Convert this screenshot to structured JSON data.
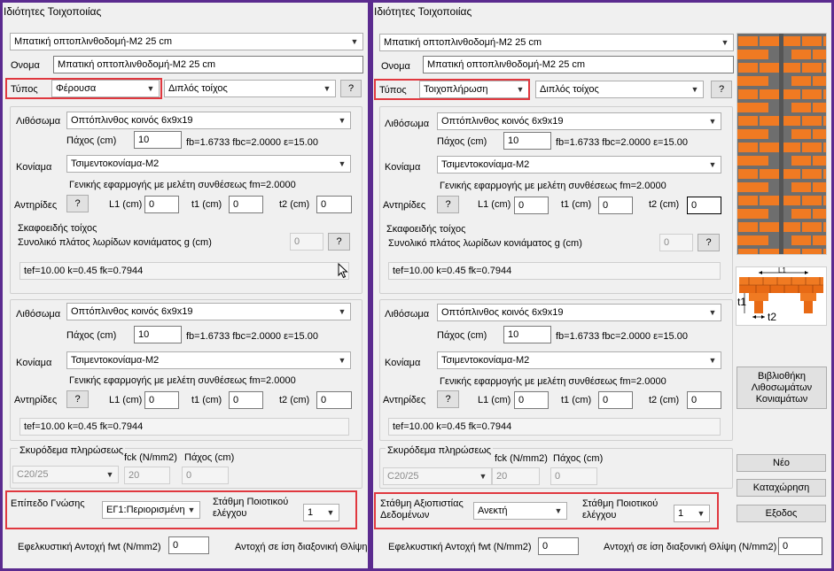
{
  "left": {
    "title": "Ιδιότητες Τοιχοποιίας",
    "wall_type": "Μπατική οπτοπλινθοδομή-Μ2 25 cm",
    "name_label": "Ονομα",
    "name_value": "Μπατική οπτοπλινθοδομή-Μ2 25 cm",
    "type_label": "Τύπος",
    "type_value": "Φέρουσα",
    "wall_kind": "Διπλός τοίχος",
    "help": "?",
    "layer1": {
      "block_label": "Λιθόσωμα",
      "block": "Οπτόπλινθος κοινός 6x9x19",
      "thickness_label": "Πάχος (cm)",
      "thickness": "10",
      "props": "fb=1.6733 fbc=2.0000 ε=15.00",
      "mortar_label": "Κονίαμα",
      "mortar": "Τσιμεντοκονίαμα-Μ2",
      "mortar_note": "Γενικής εφαρμογής με μελέτη συνθέσεως fm=2.0000",
      "ties_label": "Αντηρίδες",
      "ties_btn": "?",
      "l1_label": "L1 (cm)",
      "l1": "0",
      "t1_label": "t1 (cm)",
      "t1": "0",
      "t2_label": "t2 (cm)",
      "t2": "0",
      "shell_label": "Σκαφοειδής τοίχος",
      "shell_note": "Συνολικό πλάτος λωρίδων κονιάματος g (cm)",
      "g": "0",
      "g_btn": "?",
      "result": "tef=10.00 k=0.45 fk=0.7944"
    },
    "layer2": {
      "block_label": "Λιθόσωμα",
      "block": "Οπτόπλινθος κοινός 6x9x19",
      "thickness_label": "Πάχος (cm)",
      "thickness": "10",
      "props": "fb=1.6733 fbc=2.0000 ε=15.00",
      "mortar_label": "Κονίαμα",
      "mortar": "Τσιμεντοκονίαμα-Μ2",
      "mortar_note": "Γενικής εφαρμογής με μελέτη συνθέσεως fm=2.0000",
      "ties_label": "Αντηρίδες",
      "ties_btn": "?",
      "l1_label": "L1 (cm)",
      "l1": "0",
      "t1_label": "t1 (cm)",
      "t1": "0",
      "t2_label": "t2 (cm)",
      "t2": "0",
      "result": "tef=10.00 k=0.45 fk=0.7944"
    },
    "concrete_label": "Σκυρόδεμα πληρώσεως",
    "concrete": "C20/25",
    "fck_label": "fck (N/mm2)",
    "fck": "20",
    "conc_thick_label": "Πάχος (cm)",
    "conc_thick": "0",
    "knowledge_label": "Επίπεδο Γνώσης",
    "knowledge": "ΕΓ1:Περιορισμένη",
    "quality_label": "Στάθμη Ποιοτικού ελέγχου",
    "quality": "1",
    "tensile_label": "Εφελκυστική Αντοχή fwt (N/mm2)",
    "tensile": "0",
    "shear_label": "Αντοχή σε ίση διαξονική Θλίψη"
  },
  "right": {
    "title": "Ιδιότητες Τοιχοποιίας",
    "wall_type": "Μπατική οπτοπλινθοδομή-Μ2 25 cm",
    "name_label": "Ονομα",
    "name_value": "Μπατική οπτοπλινθοδομή-Μ2 25 cm",
    "type_label": "Τύπος",
    "type_value": "Τοιχοπλήρωση",
    "wall_kind": "Διπλός τοίχος",
    "help": "?",
    "layer1": {
      "block_label": "Λιθόσωμα",
      "block": "Οπτόπλινθος κοινός 6x9x19",
      "thickness_label": "Πάχος (cm)",
      "thickness": "10",
      "props": "fb=1.6733 fbc=2.0000 ε=15.00",
      "mortar_label": "Κονίαμα",
      "mortar": "Τσιμεντοκονίαμα-Μ2",
      "mortar_note": "Γενικής εφαρμογής με μελέτη συνθέσεως fm=2.0000",
      "ties_label": "Αντηρίδες",
      "ties_btn": "?",
      "l1_label": "L1 (cm)",
      "l1": "0",
      "t1_label": "t1 (cm)",
      "t1": "0",
      "t2_label": "t2 (cm)",
      "t2": "0",
      "shell_label": "Σκαφοειδής τοίχος",
      "shell_note": "Συνολικό πλάτος λωρίδων κονιάματος g (cm)",
      "g": "0",
      "g_btn": "?",
      "result": "tef=10.00 k=0.45 fk=0.7944"
    },
    "layer2": {
      "block_label": "Λιθόσωμα",
      "block": "Οπτόπλινθος κοινός 6x9x19",
      "thickness_label": "Πάχος (cm)",
      "thickness": "10",
      "props": "fb=1.6733 fbc=2.0000 ε=15.00",
      "mortar_label": "Κονίαμα",
      "mortar": "Τσιμεντοκονίαμα-Μ2",
      "mortar_note": "Γενικής εφαρμογής με μελέτη συνθέσεως fm=2.0000",
      "ties_label": "Αντηρίδες",
      "ties_btn": "?",
      "l1_label": "L1 (cm)",
      "l1": "0",
      "t1_label": "t1 (cm)",
      "t1": "0",
      "t2_label": "t2 (cm)",
      "t2": "0",
      "result": "tef=10.00 k=0.45 fk=0.7944"
    },
    "concrete_label": "Σκυρόδεμα πληρώσεως",
    "concrete": "C20/25",
    "fck_label": "fck (N/mm2)",
    "fck": "20",
    "conc_thick_label": "Πάχος (cm)",
    "conc_thick": "0",
    "reliability_label": "Στάθμη Αξιοπιστίας Δεδομένων",
    "reliability": "Ανεκτή",
    "quality_label": "Στάθμη Ποιοτικού ελέγχου",
    "quality": "1",
    "tensile_label": "Εφελκυστική Αντοχή fwt (N/mm2)",
    "tensile": "0",
    "shear_label": "Αντοχή σε ίση διαξονική Θλίψη (N/mm2)",
    "shear": "0",
    "diagram": {
      "l1": "L1",
      "t1": "t1",
      "t2": "t2"
    },
    "library_btn": "Βιβλιοθήκη Λιθοσωμάτων Κονιαμάτων",
    "new_btn": "Νέο",
    "save_btn": "Καταχώρηση",
    "exit_btn": "Εξοδος"
  },
  "colors": {
    "highlight": "#e0383f",
    "frame": "#5b2b8f",
    "brick": "#f07a22"
  }
}
